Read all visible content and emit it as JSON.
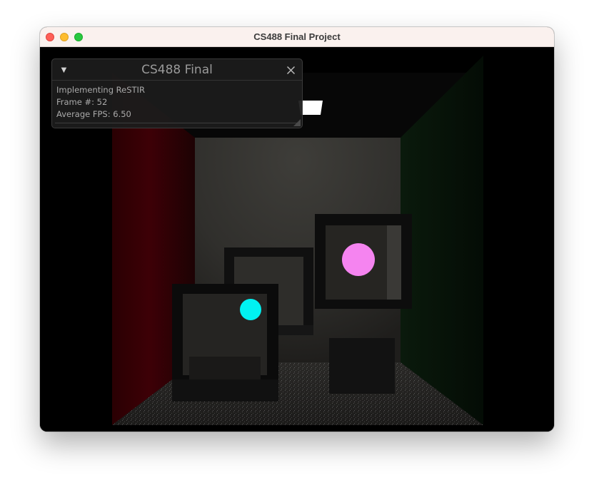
{
  "window": {
    "title": "CS488 Final Project",
    "controls": [
      "close",
      "minimize",
      "maximize"
    ]
  },
  "overlay": {
    "title": "CS488 Final",
    "collapse_glyph": "▼",
    "lines": [
      "Implementing ReSTIR",
      "Frame #: 52",
      "Average FPS: 6.50"
    ]
  },
  "colors": {
    "left_wall": "#3a0005",
    "right_wall": "#071408",
    "back_wall": "#3a3936",
    "pink_sphere": "#f584f0",
    "cyan_sphere": "#00f2f2",
    "light": "#ffffff"
  },
  "icons": {
    "collapse": "triangle-down-icon",
    "close": "close-icon",
    "resize": "resize-grip-icon"
  }
}
